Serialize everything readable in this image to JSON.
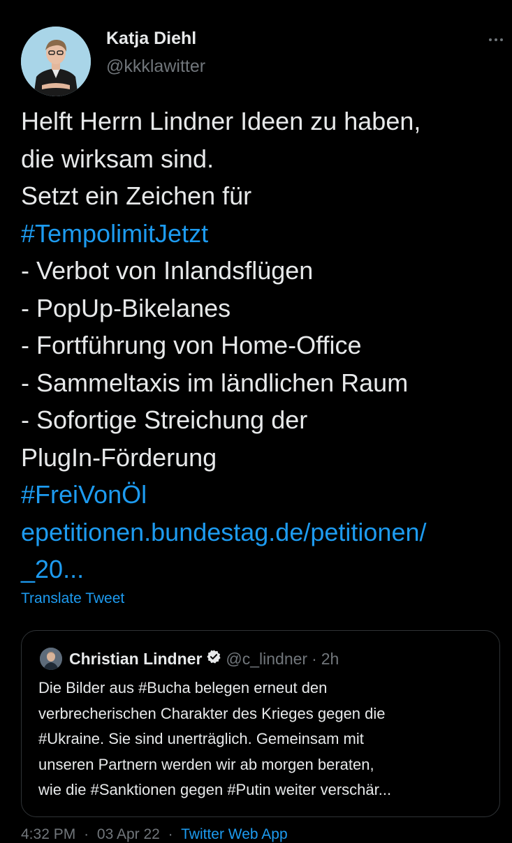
{
  "author": {
    "name": "Katja Diehl",
    "handle": "@kkklawitter"
  },
  "tweet": {
    "lines": [
      {
        "text": "Helft Herrn Lindner Ideen zu haben,",
        "type": "text"
      },
      {
        "text": "die wirksam sind.",
        "type": "text"
      },
      {
        "text": "Setzt ein Zeichen für",
        "type": "text"
      },
      {
        "text": "#TempolimitJetzt",
        "type": "hashtag"
      },
      {
        "text": "- Verbot von Inlandsflügen",
        "type": "text"
      },
      {
        "text": "- PopUp-Bikelanes",
        "type": "text"
      },
      {
        "text": "- Fortführung von Home-Office",
        "type": "text"
      },
      {
        "text": "- Sammeltaxis im ländlichen Raum",
        "type": "text"
      },
      {
        "text": "- Sofortige Streichung der",
        "type": "text"
      },
      {
        "text": "PlugIn-Förderung",
        "type": "text"
      },
      {
        "text": "#FreiVonÖl",
        "type": "hashtag"
      },
      {
        "text": "epetitionen.bundestag.de/petitionen/",
        "type": "link"
      },
      {
        "text": "_20...",
        "type": "link"
      }
    ],
    "translate_label": "Translate Tweet"
  },
  "quoted_tweet": {
    "name": "Christian Lindner",
    "handle": "@c_lindner",
    "separator": "·",
    "time": "2h",
    "lines": [
      "Die Bilder aus #Bucha belegen erneut den",
      "verbrecherischen Charakter des Krieges gegen die",
      "#Ukraine. Sie sind unerträglich. Gemeinsam mit",
      "unseren Partnern werden wir ab morgen beraten,",
      "wie die #Sanktionen gegen #Putin weiter verschär..."
    ]
  },
  "footer": {
    "time": "4:32 PM",
    "separator": "·",
    "date": "03 Apr 22",
    "source": "Twitter Web App"
  },
  "colors": {
    "background": "#000000",
    "text": "#e7e9ea",
    "secondary": "#71767b",
    "accent": "#1d9bf0",
    "border": "#2f3336"
  },
  "icons": {
    "more": "more-horizontal-icon",
    "verified": "verified-badge-icon"
  }
}
